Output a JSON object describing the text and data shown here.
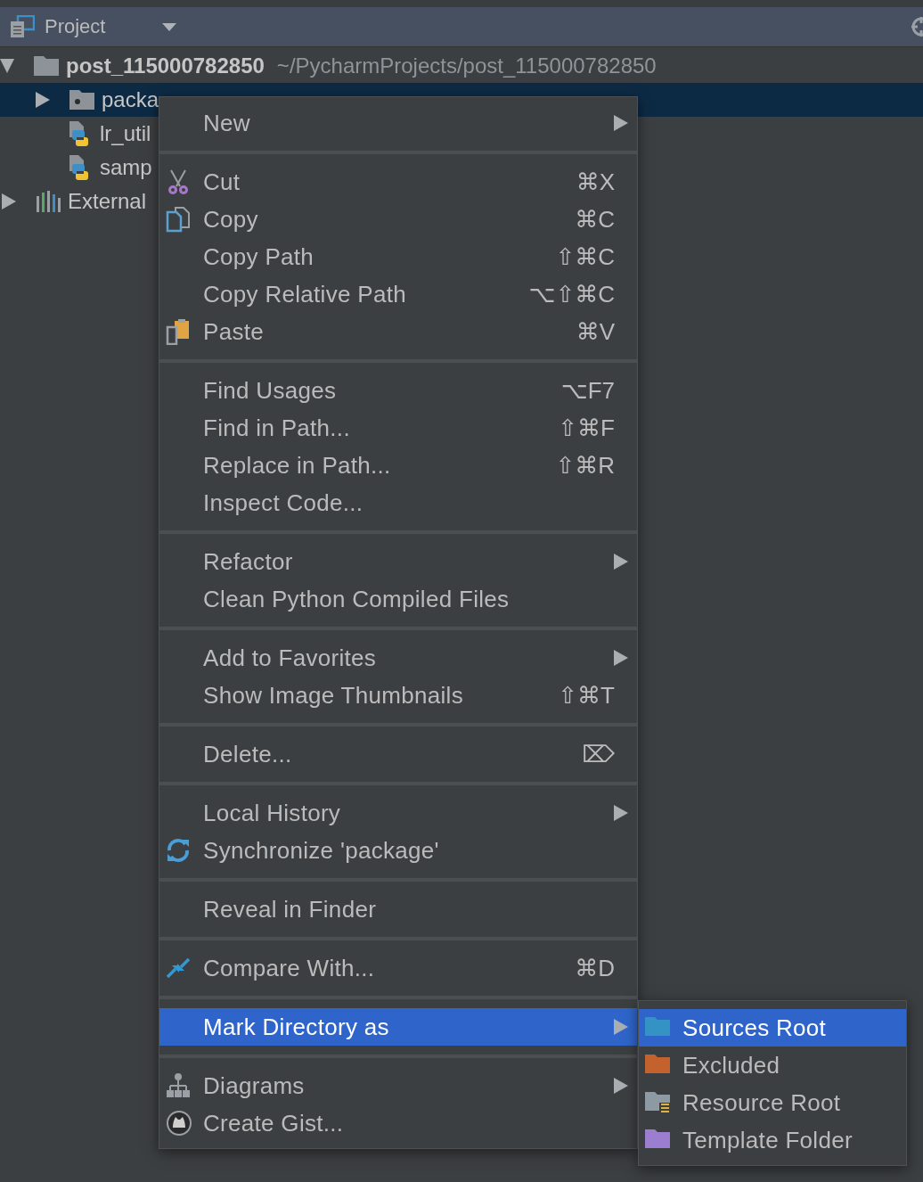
{
  "panel": {
    "title": "Project"
  },
  "tree": [
    {
      "label": "post_115000782850",
      "path": "~/PycharmProjects/post_115000782850",
      "kind": "folder",
      "expanded": true,
      "selected": false,
      "children": [
        {
          "label": "packa",
          "kind": "package",
          "expanded": false,
          "selected": true
        },
        {
          "label": "lr_util",
          "kind": "python",
          "selected": false
        },
        {
          "label": "samp",
          "kind": "python",
          "selected": false
        }
      ]
    },
    {
      "label": "External",
      "kind": "library",
      "expanded": false,
      "selected": false
    }
  ],
  "menu": {
    "groups": [
      [
        {
          "label": "New",
          "kind": "plain",
          "submenu": true,
          "selected": false
        }
      ],
      [
        {
          "label": "Cut",
          "kind": "cut",
          "shortcut": "⌘X",
          "submenu": false,
          "selected": false
        },
        {
          "label": "Copy",
          "kind": "copy",
          "shortcut": "⌘C",
          "submenu": false,
          "selected": false
        },
        {
          "label": "Copy Path",
          "kind": "plain",
          "shortcut": "⇧⌘C",
          "submenu": false,
          "selected": false
        },
        {
          "label": "Copy Relative Path",
          "kind": "plain",
          "shortcut": "⌥⇧⌘C",
          "submenu": false,
          "selected": false
        },
        {
          "label": "Paste",
          "kind": "paste",
          "shortcut": "⌘V",
          "submenu": false,
          "selected": false
        }
      ],
      [
        {
          "label": "Find Usages",
          "kind": "plain",
          "shortcut": "⌥F7",
          "submenu": false,
          "selected": false
        },
        {
          "label": "Find in Path...",
          "kind": "plain",
          "shortcut": "⇧⌘F",
          "submenu": false,
          "selected": false
        },
        {
          "label": "Replace in Path...",
          "kind": "plain",
          "shortcut": "⇧⌘R",
          "submenu": false,
          "selected": false
        },
        {
          "label": "Inspect Code...",
          "kind": "plain",
          "submenu": false,
          "selected": false
        }
      ],
      [
        {
          "label": "Refactor",
          "kind": "plain",
          "submenu": true,
          "selected": false
        },
        {
          "label": "Clean Python Compiled Files",
          "kind": "plain",
          "submenu": false,
          "selected": false
        }
      ],
      [
        {
          "label": "Add to Favorites",
          "kind": "plain",
          "submenu": true,
          "selected": false
        },
        {
          "label": "Show Image Thumbnails",
          "kind": "plain",
          "shortcut": "⇧⌘T",
          "submenu": false,
          "selected": false
        }
      ],
      [
        {
          "label": "Delete...",
          "kind": "plain",
          "shortcut": "⌦",
          "submenu": false,
          "selected": false
        }
      ],
      [
        {
          "label": "Local History",
          "kind": "plain",
          "submenu": true,
          "selected": false
        },
        {
          "label": "Synchronize 'package'",
          "kind": "sync",
          "submenu": false,
          "selected": false
        }
      ],
      [
        {
          "label": "Reveal in Finder",
          "kind": "plain",
          "submenu": false,
          "selected": false
        }
      ],
      [
        {
          "label": "Compare With...",
          "kind": "compare",
          "shortcut": "⌘D",
          "submenu": false,
          "selected": false
        }
      ],
      [
        {
          "label": "Mark Directory as",
          "kind": "plain",
          "submenu": true,
          "selected": true
        }
      ],
      [
        {
          "label": "Diagrams",
          "kind": "diagrams",
          "submenu": true,
          "selected": false
        },
        {
          "label": "Create Gist...",
          "kind": "gist",
          "submenu": false,
          "selected": false
        }
      ]
    ]
  },
  "submenu": [
    {
      "label": "Sources Root",
      "color": "#3592c4",
      "resource": false,
      "selected": true
    },
    {
      "label": "Excluded",
      "color": "#c3622c",
      "resource": false,
      "selected": false
    },
    {
      "label": "Resource Root",
      "color": "#8d9aa3",
      "resource": true,
      "selected": false
    },
    {
      "label": "Template Folder",
      "color": "#9b7ed0",
      "resource": false,
      "selected": false
    }
  ]
}
